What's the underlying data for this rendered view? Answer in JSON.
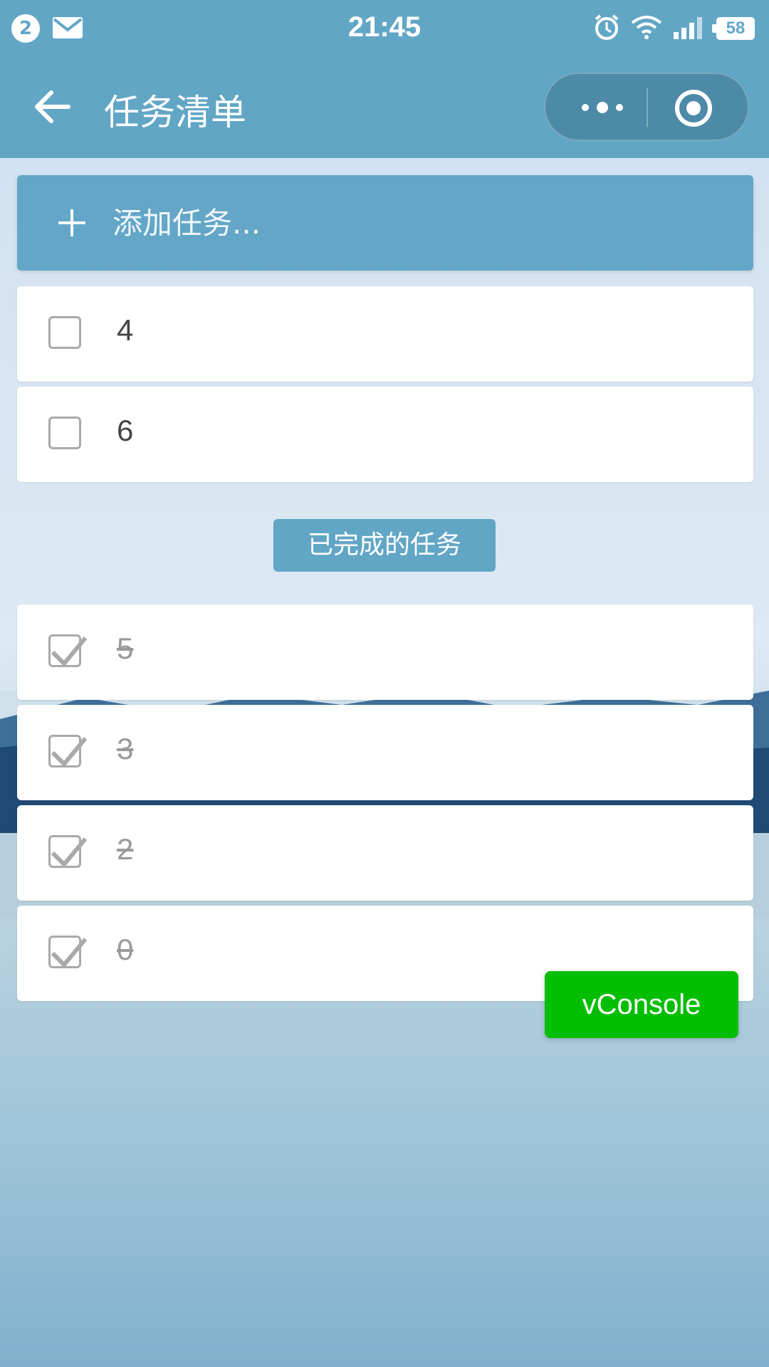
{
  "status_bar": {
    "notification_count": "2",
    "time": "21:45",
    "battery": "58",
    "icons": [
      "mail-icon",
      "alarm-icon",
      "wifi-icon",
      "signal-icon",
      "battery-icon"
    ]
  },
  "navbar": {
    "title": "任务清单",
    "icons": [
      "back-arrow-icon",
      "more-dots-icon",
      "close-circle-icon"
    ]
  },
  "add_task": {
    "placeholder": "添加任务..."
  },
  "pending_tasks": [
    {
      "label": "4",
      "checked": false
    },
    {
      "label": "6",
      "checked": false
    }
  ],
  "completed_section_label": "已完成的任务",
  "completed_tasks": [
    {
      "label": "5",
      "checked": true
    },
    {
      "label": "3",
      "checked": true
    },
    {
      "label": "2",
      "checked": true
    },
    {
      "label": "0",
      "checked": true
    }
  ],
  "vconsole_label": "vConsole",
  "colors": {
    "primary": "#62a6c6",
    "vconsole": "#04be02",
    "checkbox": "#a9a9a9"
  }
}
